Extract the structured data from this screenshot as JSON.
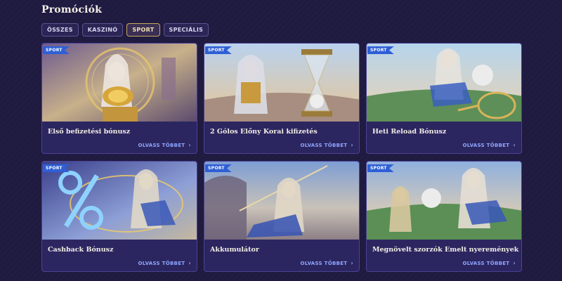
{
  "page": {
    "title": "Promóciók"
  },
  "tabs": [
    {
      "label": "ÖSSZES",
      "active": false
    },
    {
      "label": "KASZINÓ",
      "active": false
    },
    {
      "label": "SPORT",
      "active": true
    },
    {
      "label": "SPECIÁLIS",
      "active": false
    }
  ],
  "promotions": [
    {
      "badge": "SPORT",
      "title": "Első befizetési bónusz",
      "cta": "OLVASS TÖBBET"
    },
    {
      "badge": "SPORT",
      "title": "2 Gólos Előny Korai kifizetés",
      "cta": "OLVASS TÖBBET"
    },
    {
      "badge": "SPORT",
      "title": "Heti Reload Bónusz",
      "cta": "OLVASS TÖBBET"
    },
    {
      "badge": "SPORT",
      "title": "Cashback Bónusz",
      "cta": "OLVASS TÖBBET"
    },
    {
      "badge": "SPORT",
      "title": "Akkumulátor",
      "cta": "OLVASS TÖBBET"
    },
    {
      "badge": "SPORT",
      "title": "Megnövelt szorzók Emelt nyeremények",
      "cta": "OLVASS TÖBBET"
    }
  ],
  "icons": {
    "read_more": "chevron-right-icon"
  },
  "colors": {
    "background": "#1f1a40",
    "card": "#2c2660",
    "badge": "#2e5fd6",
    "link": "#8fa6ff",
    "active_tab_border": "#c9a760"
  }
}
